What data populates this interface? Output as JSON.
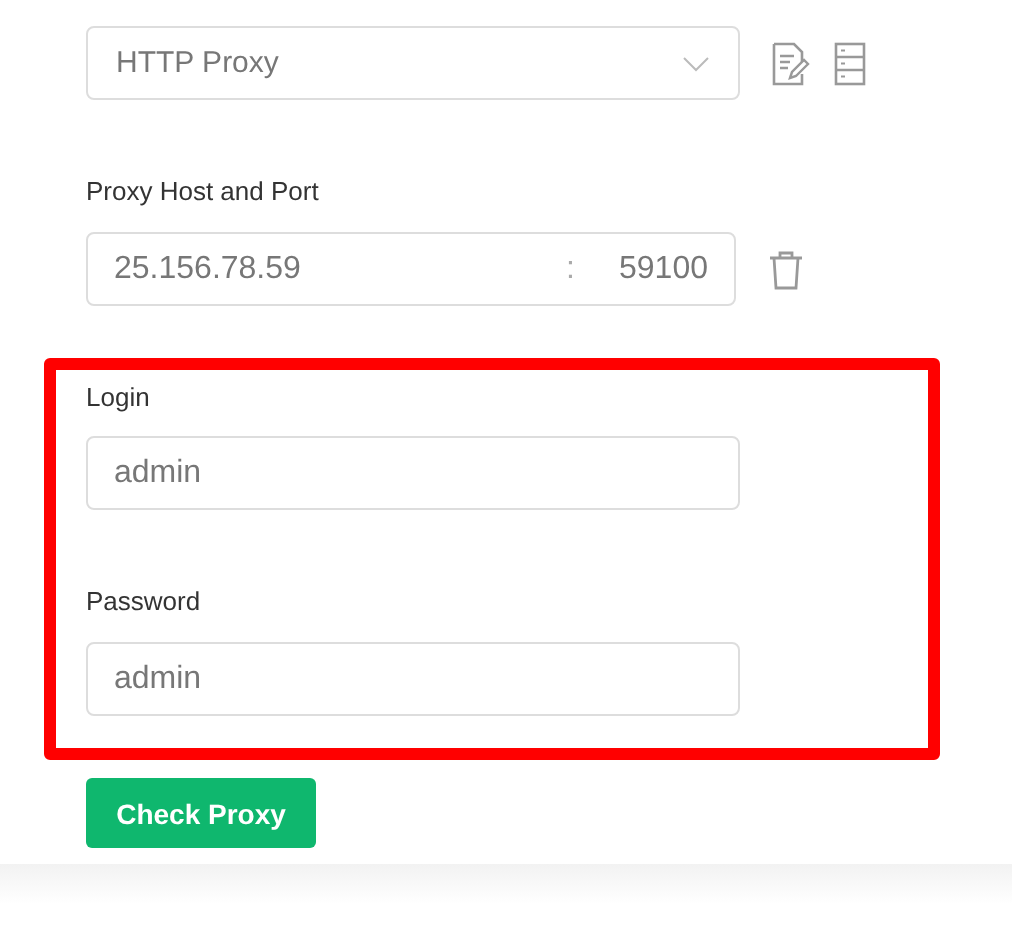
{
  "proxy_type": {
    "value": "HTTP Proxy"
  },
  "host": {
    "label": "Proxy Host and Port",
    "address": "25.156.78.59",
    "separator": ":",
    "port": "59100"
  },
  "credentials": [
    {
      "label": "Login",
      "value": "admin"
    },
    {
      "label": "Password",
      "value": "admin"
    }
  ],
  "button": "Check Proxy"
}
